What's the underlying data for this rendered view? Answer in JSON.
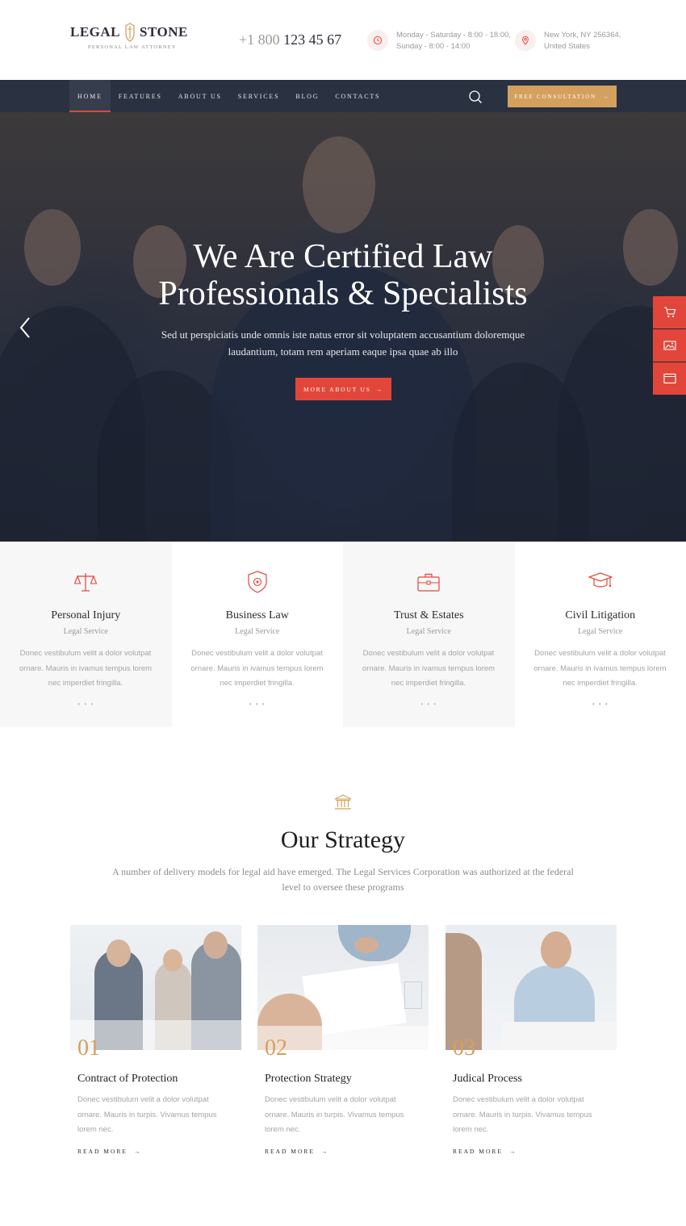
{
  "header": {
    "logo": {
      "word1": "LEGAL",
      "word2": "STONE",
      "tagline": "PERSONAL  LAW ATTORNEY"
    },
    "phone": {
      "prefix": "+1 800",
      "number": "123 45 67"
    },
    "hours": {
      "line1": "Monday - Saturday - 8:00 - 18:00,",
      "line2": "Sunday - 8:00 - 14:00",
      "icon": "clock-icon"
    },
    "location": {
      "line1": "New York, NY 256364,",
      "line2": "United States",
      "icon": "map-pin-icon"
    }
  },
  "nav": {
    "items": [
      {
        "label": "HOME",
        "active": true
      },
      {
        "label": "FEATURES",
        "active": false
      },
      {
        "label": "ABOUT US",
        "active": false
      },
      {
        "label": "SERVICES",
        "active": false
      },
      {
        "label": "BLOG",
        "active": false
      },
      {
        "label": "CONTACTS",
        "active": false
      }
    ],
    "cta": "FREE CONSULTATION"
  },
  "hero": {
    "title_line1": "We Are Certified Law",
    "title_line2": "Professionals & Specialists",
    "text_line1": "Sed ut perspiciatis unde omnis iste natus error sit voluptatem accusantium doloremque",
    "text_line2": "laudantium, totam rem aperiam eaque ipsa quae ab illo",
    "button": "MORE ABOUT US"
  },
  "side_tabs": [
    {
      "icon": "cart-icon"
    },
    {
      "icon": "image-icon"
    },
    {
      "icon": "window-icon"
    }
  ],
  "services": [
    {
      "icon": "scales-icon",
      "title": "Personal Injury",
      "subtitle": "Legal Service",
      "desc1": "Donec vestibulum velit a dolor volutpat",
      "desc2": "ornare. Mauris in ivamus tempus lorem",
      "desc3": "nec imperdiet fringilla.",
      "dots": "• • •"
    },
    {
      "icon": "shield-icon",
      "title": "Business Law",
      "subtitle": "Legal Service",
      "desc1": "Donec vestibulum velit a dolor volutpat",
      "desc2": "ornare. Mauris in ivamus tempus lorem",
      "desc3": "nec imperdiet fringilla.",
      "dots": "• • •"
    },
    {
      "icon": "briefcase-icon",
      "title": "Trust & Estates",
      "subtitle": "Legal Service",
      "desc1": "Donec vestibulum velit a dolor volutpat",
      "desc2": "ornare. Mauris in ivamus tempus lorem",
      "desc3": "nec imperdiet fringilla.",
      "dots": "• • •"
    },
    {
      "icon": "graduation-cap-icon",
      "title": "Civil Litigation",
      "subtitle": "Legal Service",
      "desc1": "Donec vestibulum velit a dolor volutpat",
      "desc2": "ornare. Mauris in ivamus tempus lorem",
      "desc3": "nec imperdiet fringilla.",
      "dots": "• • •"
    }
  ],
  "strategy": {
    "icon": "courthouse-icon",
    "title": "Our Strategy",
    "text_line1": "A number of delivery models for legal aid have emerged. The Legal Services Corporation was authorized at the federal",
    "text_line2": "level to oversee these programs",
    "cards": [
      {
        "num": "01",
        "title": "Contract of Protection",
        "desc1": "Donec vestibulum velit a dolor volutpat",
        "desc2": "ornare. Mauris in turpis. Vivamus tempus",
        "desc3": "lorem nec.",
        "more": "READ MORE"
      },
      {
        "num": "02",
        "title": "Protection Strategy",
        "desc1": "Donec vestibulum velit a dolor volutpat",
        "desc2": "ornare. Mauris in turpis. Vivamus tempus",
        "desc3": "lorem nec.",
        "more": "READ MORE"
      },
      {
        "num": "03",
        "title": "Judical Process",
        "desc1": "Donec vestibulum velit a dolor volutpat",
        "desc2": "ornare. Mauris in turpis. Vivamus tempus",
        "desc3": "lorem nec.",
        "more": "READ MORE"
      }
    ]
  },
  "colors": {
    "accent": "#e2463a",
    "gold": "#d4a05d",
    "navy": "#2a3140"
  }
}
